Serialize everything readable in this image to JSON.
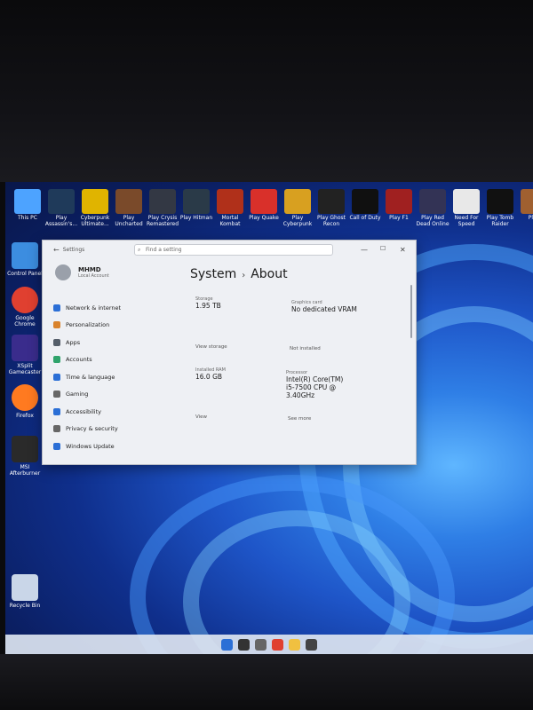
{
  "desktop": {
    "top_icons": [
      {
        "label": "This PC",
        "color": "#4da3ff"
      },
      {
        "label": "Play Assassin's...",
        "color": "#1f3a5a"
      },
      {
        "label": "Cyberpunk Ultimate...",
        "color": "#e0b400"
      },
      {
        "label": "Play Uncharted",
        "color": "#7a4a2a"
      },
      {
        "label": "Play Crysis Remastered",
        "color": "#333844"
      },
      {
        "label": "Play Hitman",
        "color": "#2a3a48"
      },
      {
        "label": "Mortal Kombat",
        "color": "#b0301a"
      },
      {
        "label": "Play Quake",
        "color": "#d9302a"
      },
      {
        "label": "Play Cyberpunk",
        "color": "#d8a020"
      },
      {
        "label": "Play Ghost Recon",
        "color": "#222"
      },
      {
        "label": "Call of Duty",
        "color": "#101010"
      },
      {
        "label": "Play F1",
        "color": "#a02020"
      },
      {
        "label": "Play Red Dead Online",
        "color": "#335"
      },
      {
        "label": "Need For Speed",
        "color": "#e8e8e8"
      },
      {
        "label": "Play Tomb Raider",
        "color": "#111"
      },
      {
        "label": "Play",
        "color": "#a06030"
      }
    ],
    "left_icons": [
      {
        "label": "Control Panel",
        "color": "#3c8de0"
      },
      {
        "label": "Google Chrome",
        "color": "#e04030"
      },
      {
        "label": "XSplit Gamecaster",
        "color": "#3a2c8c"
      },
      {
        "label": "Firefox",
        "color": "#ff7a20"
      },
      {
        "label": "MSI Afterburner",
        "color": "#2a2a2a"
      },
      {
        "label": "Recycle Bin",
        "color": "#c9d6e8"
      }
    ]
  },
  "window": {
    "back_label": "Settings",
    "search_placeholder": "Find a setting",
    "controls": {
      "minimize": "—",
      "maximize": "☐",
      "close": "✕"
    },
    "user": {
      "name": "MHMD",
      "account_type": "Local Account"
    },
    "nav": [
      {
        "label": "Network & internet",
        "icon": "wifi-icon",
        "color": "#2b6fd6"
      },
      {
        "label": "Personalization",
        "icon": "brush-icon",
        "color": "#d9822b"
      },
      {
        "label": "Apps",
        "icon": "apps-icon",
        "color": "#555e6a"
      },
      {
        "label": "Accounts",
        "icon": "person-icon",
        "color": "#2fa36b"
      },
      {
        "label": "Time & language",
        "icon": "globe-clock-icon",
        "color": "#2b6fd6"
      },
      {
        "label": "Gaming",
        "icon": "gamepad-icon",
        "color": "#666"
      },
      {
        "label": "Accessibility",
        "icon": "accessibility-icon",
        "color": "#2b6fd6"
      },
      {
        "label": "Privacy & security",
        "icon": "shield-icon",
        "color": "#666"
      },
      {
        "label": "Windows Update",
        "icon": "update-icon",
        "color": "#2b6fd6"
      }
    ],
    "breadcrumb": {
      "parent": "System",
      "separator": "›",
      "current": "About"
    },
    "specs": {
      "storage_label": "Storage",
      "storage_value": "1.95 TB",
      "graphics_label": "Graphics card",
      "graphics_value": "No dedicated VRAM",
      "ram_label": "Installed RAM",
      "ram_value": "16.0 GB",
      "processor_label": "Processor",
      "processor_value_1": "Intel(R) Core(TM)",
      "processor_value_2": "i5-7500 CPU @",
      "processor_value_3": "3.40GHz",
      "storage_link": "View storage",
      "graphics_link": "Not installed",
      "ram_note": "View",
      "processor_note": "See more"
    }
  },
  "taskbar": {
    "icons": [
      {
        "name": "start-icon",
        "color": "#2b6fd6"
      },
      {
        "name": "search-icon",
        "color": "#333"
      },
      {
        "name": "settings-icon",
        "color": "#666"
      },
      {
        "name": "chrome-icon",
        "color": "#e04030"
      },
      {
        "name": "file-explorer-icon",
        "color": "#f0c040"
      },
      {
        "name": "gear-icon",
        "color": "#444"
      }
    ]
  }
}
